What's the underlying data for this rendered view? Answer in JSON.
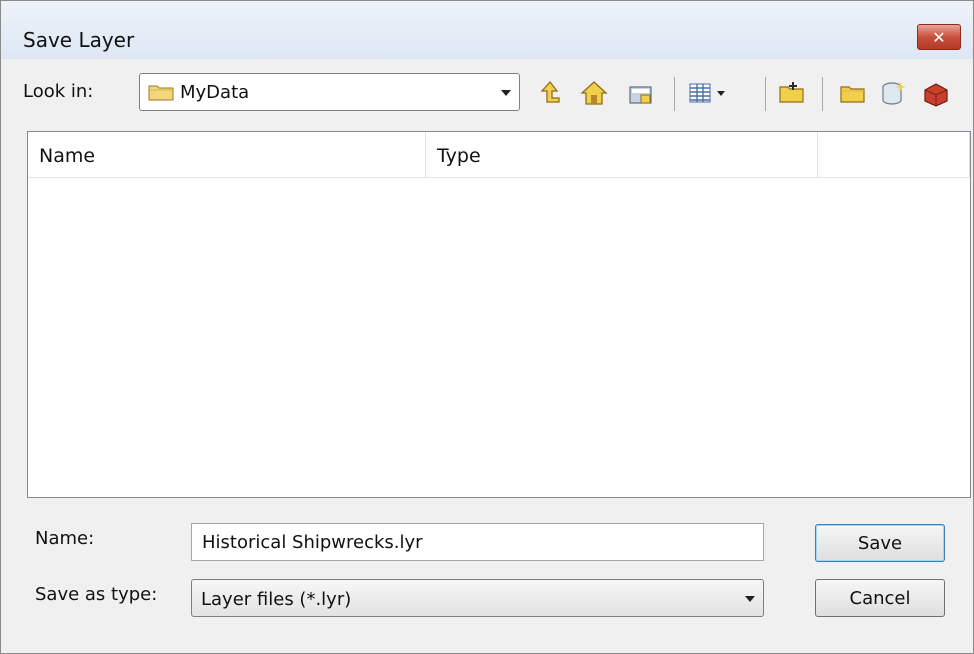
{
  "window": {
    "title": "Save Layer",
    "close_glyph": "✕"
  },
  "look_in": {
    "label": "Look in:",
    "value": "MyData"
  },
  "toolbar": {
    "icons": [
      "up-one-level-icon",
      "home-folder-icon",
      "connect-folder-icon",
      "views-icon",
      "new-folder-icon",
      "new-file-geodatabase-icon",
      "new-database-icon",
      "toolbox-icon"
    ]
  },
  "file_list": {
    "columns": [
      "Name",
      "Type",
      ""
    ],
    "rows": []
  },
  "name_field": {
    "label": "Name:",
    "value": "Historical Shipwrecks.lyr"
  },
  "type_field": {
    "label": "Save as type:",
    "value": "Layer files (*.lyr)"
  },
  "buttons": {
    "save": "Save",
    "cancel": "Cancel"
  },
  "colors": {
    "close_button": "#c8503c",
    "folder": "#f3d77a",
    "titlebar": "#dde7f3"
  }
}
